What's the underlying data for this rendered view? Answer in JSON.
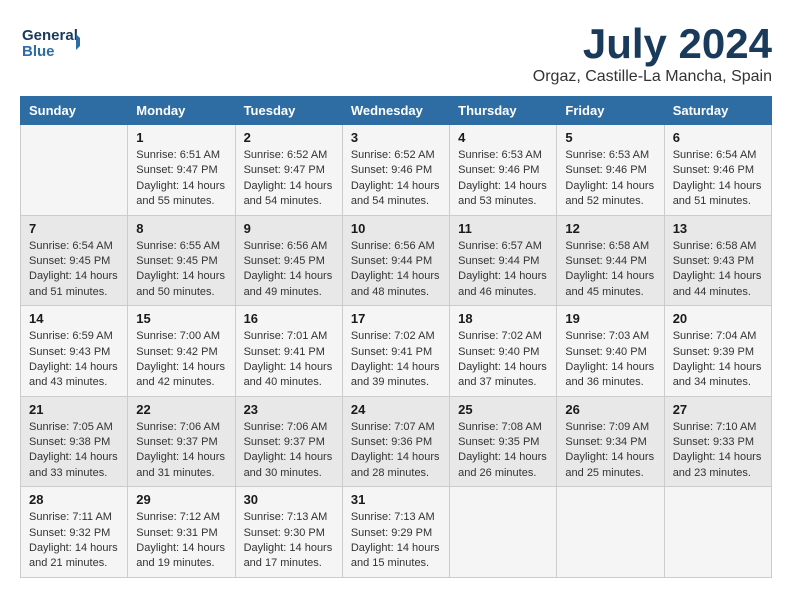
{
  "header": {
    "logo_line1": "General",
    "logo_line2": "Blue",
    "month_title": "July 2024",
    "location": "Orgaz, Castille-La Mancha, Spain"
  },
  "days_of_week": [
    "Sunday",
    "Monday",
    "Tuesday",
    "Wednesday",
    "Thursday",
    "Friday",
    "Saturday"
  ],
  "weeks": [
    [
      {
        "day": "",
        "info": ""
      },
      {
        "day": "1",
        "info": "Sunrise: 6:51 AM\nSunset: 9:47 PM\nDaylight: 14 hours\nand 55 minutes."
      },
      {
        "day": "2",
        "info": "Sunrise: 6:52 AM\nSunset: 9:47 PM\nDaylight: 14 hours\nand 54 minutes."
      },
      {
        "day": "3",
        "info": "Sunrise: 6:52 AM\nSunset: 9:46 PM\nDaylight: 14 hours\nand 54 minutes."
      },
      {
        "day": "4",
        "info": "Sunrise: 6:53 AM\nSunset: 9:46 PM\nDaylight: 14 hours\nand 53 minutes."
      },
      {
        "day": "5",
        "info": "Sunrise: 6:53 AM\nSunset: 9:46 PM\nDaylight: 14 hours\nand 52 minutes."
      },
      {
        "day": "6",
        "info": "Sunrise: 6:54 AM\nSunset: 9:46 PM\nDaylight: 14 hours\nand 51 minutes."
      }
    ],
    [
      {
        "day": "7",
        "info": "Sunrise: 6:54 AM\nSunset: 9:45 PM\nDaylight: 14 hours\nand 51 minutes."
      },
      {
        "day": "8",
        "info": "Sunrise: 6:55 AM\nSunset: 9:45 PM\nDaylight: 14 hours\nand 50 minutes."
      },
      {
        "day": "9",
        "info": "Sunrise: 6:56 AM\nSunset: 9:45 PM\nDaylight: 14 hours\nand 49 minutes."
      },
      {
        "day": "10",
        "info": "Sunrise: 6:56 AM\nSunset: 9:44 PM\nDaylight: 14 hours\nand 48 minutes."
      },
      {
        "day": "11",
        "info": "Sunrise: 6:57 AM\nSunset: 9:44 PM\nDaylight: 14 hours\nand 46 minutes."
      },
      {
        "day": "12",
        "info": "Sunrise: 6:58 AM\nSunset: 9:44 PM\nDaylight: 14 hours\nand 45 minutes."
      },
      {
        "day": "13",
        "info": "Sunrise: 6:58 AM\nSunset: 9:43 PM\nDaylight: 14 hours\nand 44 minutes."
      }
    ],
    [
      {
        "day": "14",
        "info": "Sunrise: 6:59 AM\nSunset: 9:43 PM\nDaylight: 14 hours\nand 43 minutes."
      },
      {
        "day": "15",
        "info": "Sunrise: 7:00 AM\nSunset: 9:42 PM\nDaylight: 14 hours\nand 42 minutes."
      },
      {
        "day": "16",
        "info": "Sunrise: 7:01 AM\nSunset: 9:41 PM\nDaylight: 14 hours\nand 40 minutes."
      },
      {
        "day": "17",
        "info": "Sunrise: 7:02 AM\nSunset: 9:41 PM\nDaylight: 14 hours\nand 39 minutes."
      },
      {
        "day": "18",
        "info": "Sunrise: 7:02 AM\nSunset: 9:40 PM\nDaylight: 14 hours\nand 37 minutes."
      },
      {
        "day": "19",
        "info": "Sunrise: 7:03 AM\nSunset: 9:40 PM\nDaylight: 14 hours\nand 36 minutes."
      },
      {
        "day": "20",
        "info": "Sunrise: 7:04 AM\nSunset: 9:39 PM\nDaylight: 14 hours\nand 34 minutes."
      }
    ],
    [
      {
        "day": "21",
        "info": "Sunrise: 7:05 AM\nSunset: 9:38 PM\nDaylight: 14 hours\nand 33 minutes."
      },
      {
        "day": "22",
        "info": "Sunrise: 7:06 AM\nSunset: 9:37 PM\nDaylight: 14 hours\nand 31 minutes."
      },
      {
        "day": "23",
        "info": "Sunrise: 7:06 AM\nSunset: 9:37 PM\nDaylight: 14 hours\nand 30 minutes."
      },
      {
        "day": "24",
        "info": "Sunrise: 7:07 AM\nSunset: 9:36 PM\nDaylight: 14 hours\nand 28 minutes."
      },
      {
        "day": "25",
        "info": "Sunrise: 7:08 AM\nSunset: 9:35 PM\nDaylight: 14 hours\nand 26 minutes."
      },
      {
        "day": "26",
        "info": "Sunrise: 7:09 AM\nSunset: 9:34 PM\nDaylight: 14 hours\nand 25 minutes."
      },
      {
        "day": "27",
        "info": "Sunrise: 7:10 AM\nSunset: 9:33 PM\nDaylight: 14 hours\nand 23 minutes."
      }
    ],
    [
      {
        "day": "28",
        "info": "Sunrise: 7:11 AM\nSunset: 9:32 PM\nDaylight: 14 hours\nand 21 minutes."
      },
      {
        "day": "29",
        "info": "Sunrise: 7:12 AM\nSunset: 9:31 PM\nDaylight: 14 hours\nand 19 minutes."
      },
      {
        "day": "30",
        "info": "Sunrise: 7:13 AM\nSunset: 9:30 PM\nDaylight: 14 hours\nand 17 minutes."
      },
      {
        "day": "31",
        "info": "Sunrise: 7:13 AM\nSunset: 9:29 PM\nDaylight: 14 hours\nand 15 minutes."
      },
      {
        "day": "",
        "info": ""
      },
      {
        "day": "",
        "info": ""
      },
      {
        "day": "",
        "info": ""
      }
    ]
  ]
}
